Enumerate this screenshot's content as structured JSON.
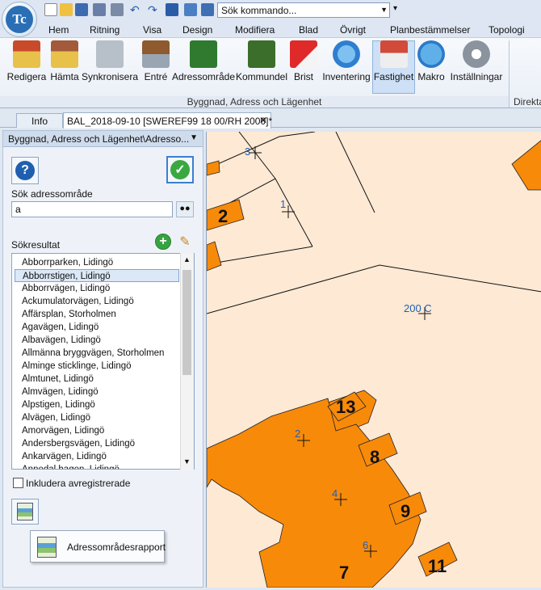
{
  "app": {
    "logo_text": "Tc",
    "command_search_placeholder": "Sök kommando..."
  },
  "menu": [
    "Hem",
    "Ritning",
    "Visa",
    "Design",
    "Modifiera",
    "Blad",
    "Övrigt",
    "Planbestämmelser",
    "Topologi"
  ],
  "ribbon": {
    "buttons": [
      "Redigera",
      "Hämta",
      "Synkronisera",
      "Entré",
      "Adressområde",
      "Kommundel",
      "Brist",
      "Inventering",
      "Fastighet",
      "Makro",
      "Inställningar"
    ],
    "group_label": "Byggnad, Adress och Lägenhet",
    "group2_label": "Direkta"
  },
  "tabs": {
    "info": "Info",
    "document": "BAL_2018-09-10 [SWEREF99 18 00/RH 2000]*",
    "close_glyph": "✕"
  },
  "panel": {
    "title": "Byggnad, Adress och Lägenhet\\Adresso...",
    "search_label": "Sök adressområde",
    "search_value": "a",
    "results_label": "Sökresultat",
    "results": [
      "Abborrparken, Lidingö",
      "Abborrstigen, Lidingö",
      "Abborrvägen, Lidingö",
      "Ackumulatorvägen, Lidingö",
      "Affärsplan, Storholmen",
      "Agavägen, Lidingö",
      "Albavägen, Lidingö",
      "Allmänna bryggvägen, Storholmen",
      "Alminge sticklinge, Lidingö",
      "Almtunet, Lidingö",
      "Almvägen, Lidingö",
      "Alpstigen, Lidingö",
      "Alvägen, Lidingö",
      "Amorvägen, Lidingö",
      "Andersbergsvägen, Lidingö",
      "Ankarvägen, Lidingö",
      "Annedal hagen, Lidingö"
    ],
    "selected_index": 1,
    "include_unregistered_label": "Inkludera avregistrerade",
    "report_tooltip": "Adressområdesrapport"
  },
  "map": {
    "building_numbers": [
      "2",
      "13",
      "8",
      "9",
      "7",
      "11"
    ],
    "point_labels": [
      "3",
      "1",
      "200 C",
      "2",
      "4",
      "6"
    ]
  }
}
